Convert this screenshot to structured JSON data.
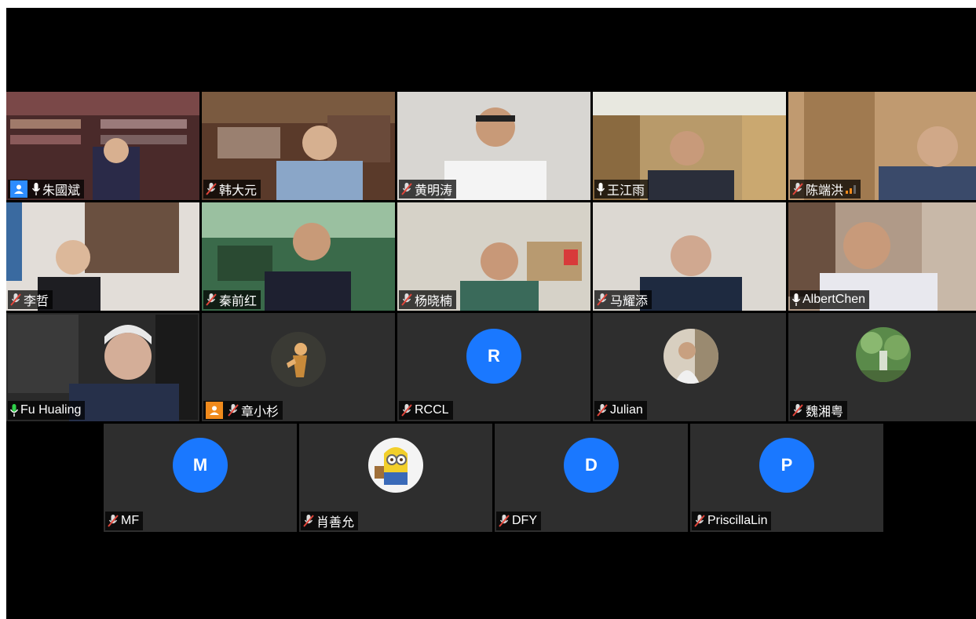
{
  "participants": [
    {
      "name": "朱國斌",
      "host_badge": "person-icon",
      "badge_color": "#2d8cff",
      "mic": "unmuted"
    },
    {
      "name": "韩大元",
      "mic": "muted"
    },
    {
      "name": "黄明涛",
      "mic": "muted"
    },
    {
      "name": "王江雨",
      "mic": "unmuted"
    },
    {
      "name": "陈端洪",
      "mic": "muted",
      "signal": "weak"
    },
    {
      "name": "李哲",
      "mic": "muted"
    },
    {
      "name": "秦前红",
      "mic": "muted"
    },
    {
      "name": "杨晓楠",
      "mic": "muted"
    },
    {
      "name": "马耀添",
      "mic": "muted"
    },
    {
      "name": "AlbertChen",
      "mic": "unmuted"
    },
    {
      "name": "Fu Hualing",
      "mic": "speaking",
      "active_speaker": true
    },
    {
      "name": "章小杉",
      "host_badge": "person-icon",
      "badge_color": "#f08a1c",
      "mic": "muted",
      "avatar": "photo"
    },
    {
      "name": "RCCL",
      "mic": "muted",
      "avatar_letter": "R"
    },
    {
      "name": "Julian",
      "mic": "muted",
      "avatar": "photo"
    },
    {
      "name": "魏湘粤",
      "mic": "muted",
      "avatar": "photo"
    },
    {
      "name": "MF",
      "mic": "muted",
      "avatar_letter": "M"
    },
    {
      "name": "肖善允",
      "mic": "muted",
      "avatar": "minion-image"
    },
    {
      "name": "DFY",
      "mic": "muted",
      "avatar_letter": "D"
    },
    {
      "name": "PriscillaLin",
      "mic": "muted",
      "avatar_letter": "P"
    }
  ],
  "colors": {
    "background": "#000000",
    "tile": "#2e2e2e",
    "avatar_blue": "#1a78ff",
    "active_speaker_border": "#2fd04a",
    "muted_mic": "#e0453a"
  }
}
